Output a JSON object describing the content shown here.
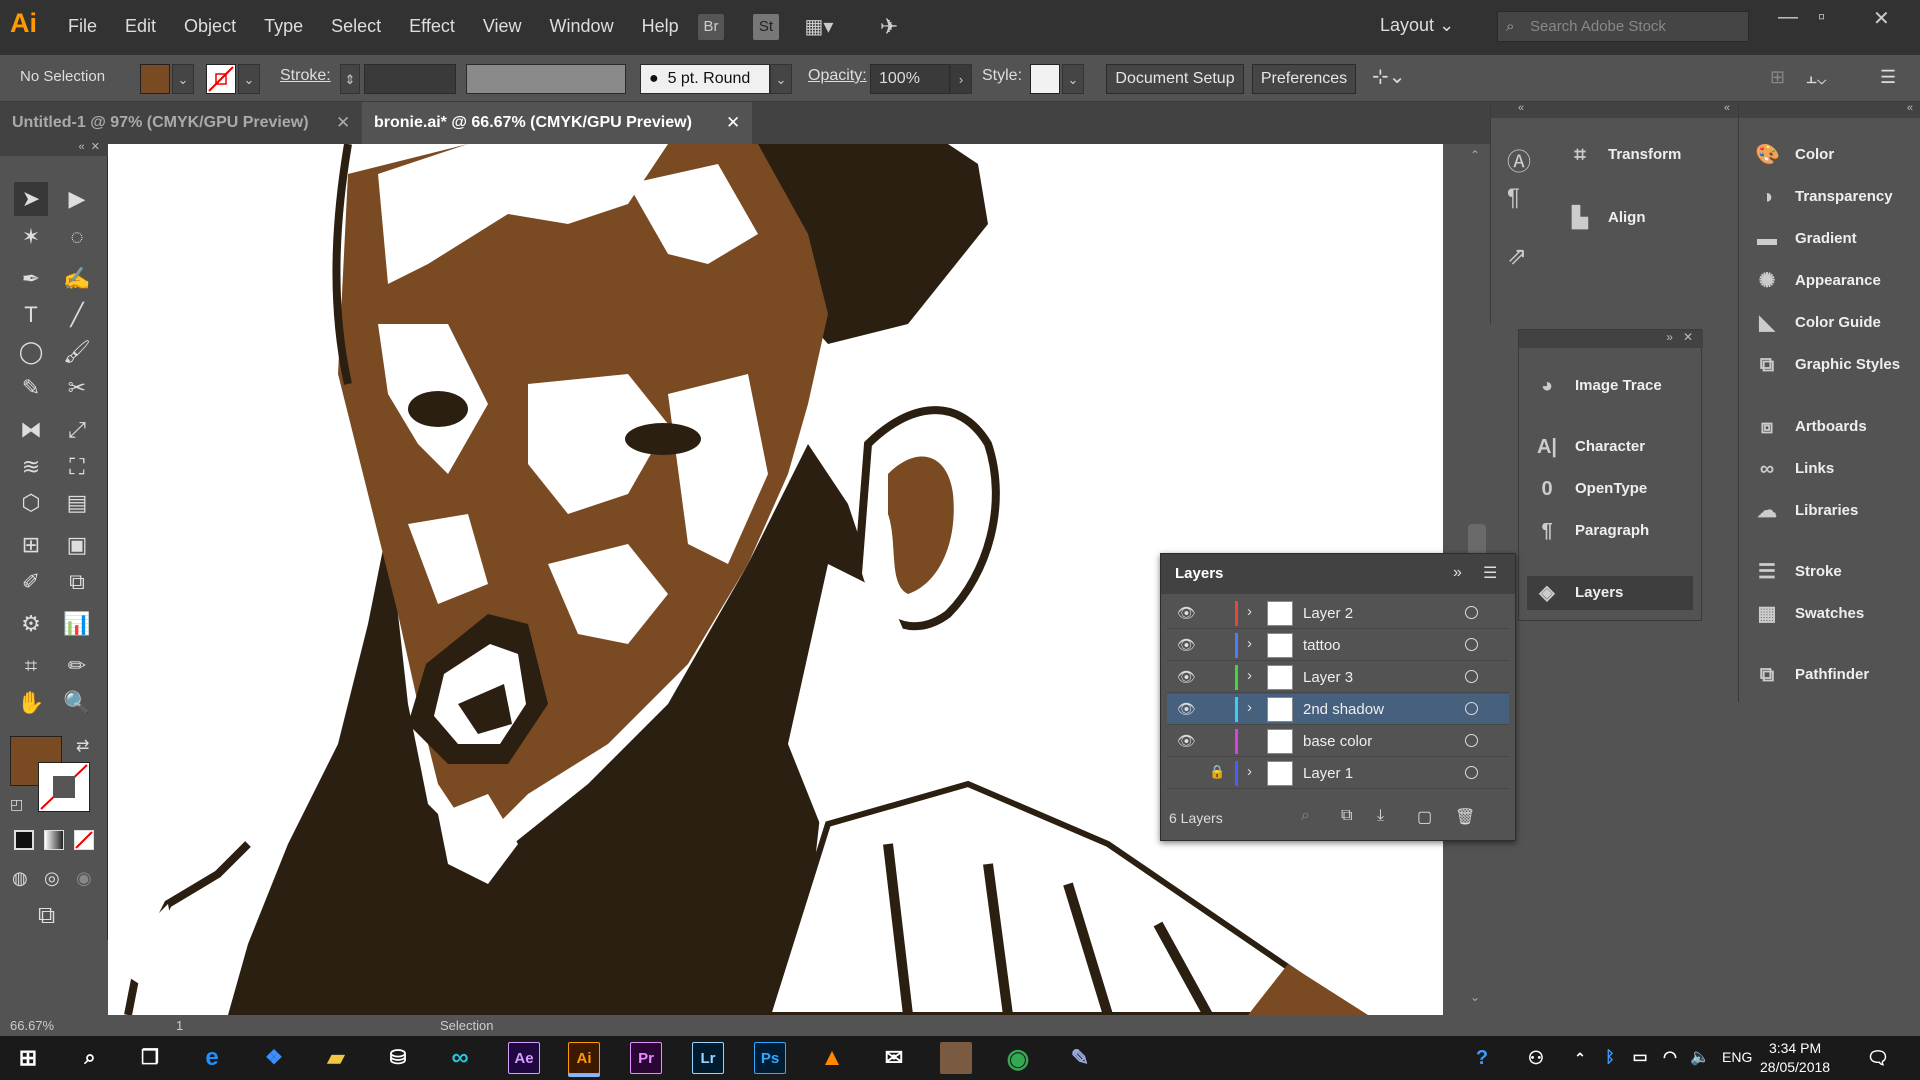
{
  "app": {
    "logo": "Ai"
  },
  "menu": [
    "File",
    "Edit",
    "Object",
    "Type",
    "Select",
    "Effect",
    "View",
    "Window",
    "Help"
  ],
  "menubar_icons": {
    "bridge": "Br",
    "stock": "St"
  },
  "workspace": {
    "label": "Layout"
  },
  "search": {
    "placeholder": "Search Adobe Stock"
  },
  "control_bar": {
    "selection": "No Selection",
    "stroke_label": "Stroke:",
    "brush": "5 pt. Round",
    "opacity_label": "Opacity:",
    "opacity_value": "100%",
    "style_label": "Style:",
    "document_setup": "Document Setup",
    "preferences": "Preferences",
    "fill_color": "#7a4a22"
  },
  "tabs": [
    {
      "label": "Untitled-1 @ 97% (CMYK/GPU Preview)",
      "active": false
    },
    {
      "label": "bronie.ai* @ 66.67% (CMYK/GPU Preview)",
      "active": true
    }
  ],
  "status": {
    "zoom": "66.67%",
    "page": "1",
    "mode": "Selection"
  },
  "dock_middle": [
    {
      "label": "Transform",
      "icon": "transform-icon"
    },
    {
      "label": "Align",
      "icon": "align-icon"
    }
  ],
  "float_panel": [
    {
      "label": "Image Trace",
      "icon": "image-trace-icon"
    },
    {
      "label": "Character",
      "icon": "character-icon"
    },
    {
      "label": "OpenType",
      "icon": "opentype-icon"
    },
    {
      "label": "Paragraph",
      "icon": "paragraph-icon"
    },
    {
      "label": "Layers",
      "icon": "layers-icon"
    }
  ],
  "dock_right": [
    {
      "label": "Color",
      "icon": "color-icon"
    },
    {
      "label": "Transparency",
      "icon": "transparency-icon"
    },
    {
      "label": "Gradient",
      "icon": "gradient-icon"
    },
    {
      "label": "Appearance",
      "icon": "appearance-icon"
    },
    {
      "label": "Color Guide",
      "icon": "color-guide-icon"
    },
    {
      "label": "Graphic Styles",
      "icon": "graphic-styles-icon"
    },
    {
      "label": "Artboards",
      "icon": "artboards-icon"
    },
    {
      "label": "Links",
      "icon": "links-icon"
    },
    {
      "label": "Libraries",
      "icon": "libraries-icon"
    },
    {
      "label": "Stroke",
      "icon": "stroke-icon"
    },
    {
      "label": "Swatches",
      "icon": "swatches-icon"
    },
    {
      "label": "Pathfinder",
      "icon": "pathfinder-icon"
    }
  ],
  "layers_panel": {
    "title": "Layers",
    "count": "6 Layers",
    "layers": [
      {
        "name": "Layer 2",
        "visible": true,
        "locked": false,
        "color": "#e8453c",
        "expandable": true,
        "selected": false
      },
      {
        "name": "tattoo",
        "visible": true,
        "locked": false,
        "color": "#4a7cff",
        "expandable": true,
        "selected": false
      },
      {
        "name": "Layer 3",
        "visible": true,
        "locked": false,
        "color": "#3fd63f",
        "expandable": true,
        "selected": false
      },
      {
        "name": "2nd shadow",
        "visible": true,
        "locked": false,
        "color": "#31d3f0",
        "expandable": true,
        "selected": true
      },
      {
        "name": "base color",
        "visible": true,
        "locked": false,
        "color": "#e03fe0",
        "expandable": false,
        "selected": false
      },
      {
        "name": "Layer 1",
        "visible": false,
        "locked": true,
        "color": "#4a5cff",
        "expandable": true,
        "selected": false
      }
    ]
  },
  "taskbar": {
    "apps": [
      "Ae",
      "Ai",
      "Pr",
      "Lr",
      "Ps"
    ],
    "language": "ENG",
    "time": "3:34 PM",
    "date": "28/05/2018"
  }
}
